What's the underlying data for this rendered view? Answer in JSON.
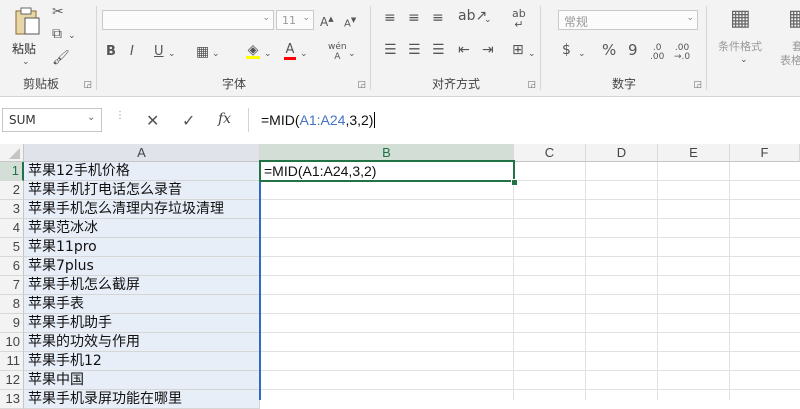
{
  "ribbon": {
    "clipboard": {
      "label": "剪贴板",
      "paste": "粘贴"
    },
    "font": {
      "label": "字体",
      "size": "11"
    },
    "alignment": {
      "label": "对齐方式"
    },
    "number": {
      "label": "数字",
      "format": "常规",
      "currency": "$",
      "percent": "%",
      "comma": "9"
    },
    "styles": {
      "conditional": "条件格式",
      "table_line1": "套",
      "table_line2": "表格格"
    }
  },
  "formula_bar": {
    "name_box": "SUM",
    "cancel": "✕",
    "enter": "✓",
    "fx": "fx",
    "formula_prefix": "=MID(",
    "formula_ref": "A1:A24",
    "formula_suffix": ",3,2)",
    "ref_color": "#4472c4"
  },
  "grid": {
    "columns": [
      "A",
      "B",
      "C",
      "D",
      "E",
      "F"
    ],
    "rows": [
      "1",
      "2",
      "3",
      "4",
      "5",
      "6",
      "7",
      "8",
      "9",
      "10",
      "11",
      "12",
      "13"
    ],
    "colA": [
      "苹果12手机价格",
      "苹果手机打电话怎么录音",
      "苹果手机怎么清理内存垃圾清理",
      "苹果范冰冰",
      "苹果11pro",
      "苹果7plus",
      "苹果手机怎么截屏",
      "苹果手表",
      "苹果手机助手",
      "苹果的功效与作用",
      "苹果手机12",
      "苹果中国",
      "苹果手机录屏功能在哪里"
    ],
    "active_cell_text": "=MID(A1:A24,3,2)",
    "selection_color": "#217346"
  }
}
